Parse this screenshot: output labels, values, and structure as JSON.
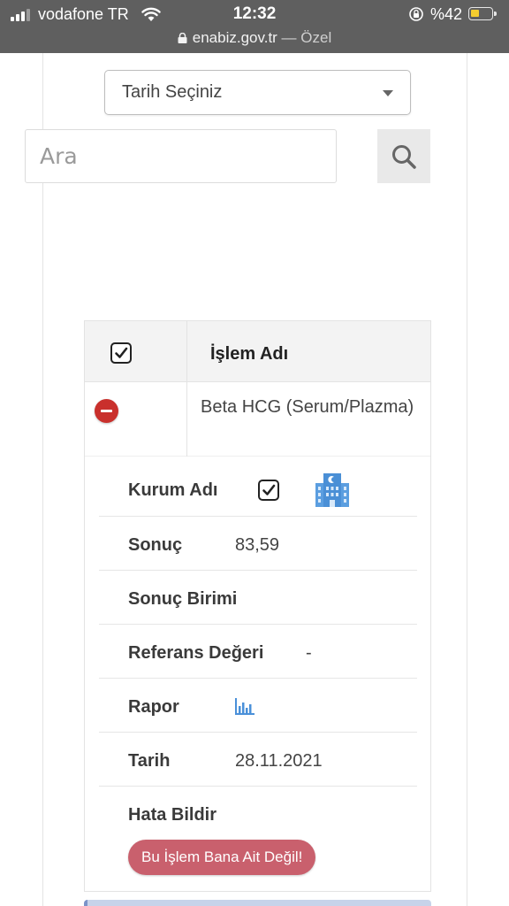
{
  "status_bar": {
    "carrier": "vodafone TR",
    "time": "12:32",
    "battery_text": "%42",
    "battery_fill_fraction": 0.42
  },
  "browser": {
    "domain": "enabiz.gov.tr",
    "separator": " — ",
    "label": "Özel"
  },
  "filter": {
    "date_select_label": "Tarih Seçiniz",
    "search_placeholder": "Ara"
  },
  "table": {
    "header_title": "İşlem Adı",
    "row_name": "Beta HCG (Serum/Plazma)",
    "details": {
      "kurum_label": "Kurum Adı",
      "sonuc_label": "Sonuç",
      "sonuc_value": "83,59",
      "birim_label": "Sonuç Birimi",
      "birim_value": "",
      "referans_label": "Referans Değeri",
      "referans_value": "-",
      "rapor_label": "Rapor",
      "tarih_label": "Tarih",
      "tarih_value": "28.11.2021",
      "hata_label": "Hata Bildir",
      "report_button": "Bu İşlem Bana Ait Değil!"
    }
  },
  "colors": {
    "danger": "#c9302c",
    "report_button": "#c9606d",
    "hospital_icon": "#4a90d9",
    "status_bar": "#5f5f5f"
  },
  "icons": {
    "search": "search-icon",
    "hospital": "hospital-icon",
    "report": "bar-chart-icon",
    "remove": "minus-circle-icon",
    "checkbox": "checkbox-checked-icon"
  }
}
